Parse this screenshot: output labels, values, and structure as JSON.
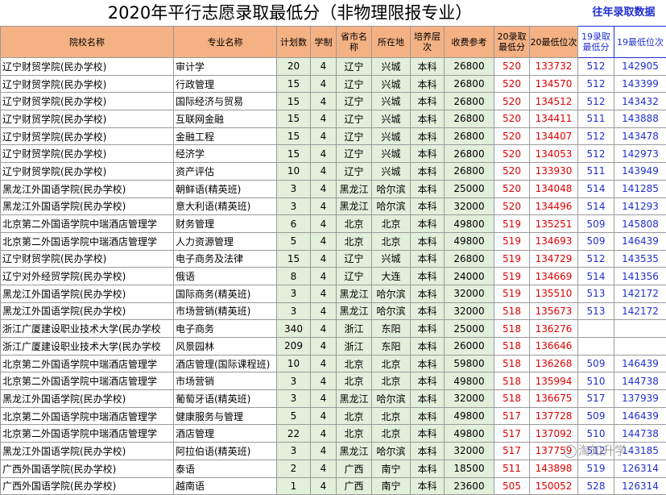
{
  "title": "2020年平行志愿录取最低分（非物理限报专业）",
  "side_title": "往年录取数据",
  "columns": [
    "院校名称",
    "专业名称",
    "计划数",
    "学制",
    "省市名称",
    "所在地",
    "培养层次",
    "收费参考",
    "20录取最低分",
    "20最低位次",
    "19录取最低分",
    "19最低位次"
  ],
  "rows": [
    [
      "辽宁财贸学院(民办学校)",
      "审计学",
      "20",
      "4",
      "辽宁",
      "兴城",
      "本科",
      "26800",
      "520",
      "133732",
      "512",
      "142905"
    ],
    [
      "辽宁财贸学院(民办学校)",
      "行政管理",
      "15",
      "4",
      "辽宁",
      "兴城",
      "本科",
      "26800",
      "520",
      "134570",
      "512",
      "143399"
    ],
    [
      "辽宁财贸学院(民办学校)",
      "国际经济与贸易",
      "15",
      "4",
      "辽宁",
      "兴城",
      "本科",
      "26800",
      "520",
      "134512",
      "512",
      "143432"
    ],
    [
      "辽宁财贸学院(民办学校)",
      "互联网金融",
      "15",
      "4",
      "辽宁",
      "兴城",
      "本科",
      "26800",
      "520",
      "134411",
      "511",
      "143888"
    ],
    [
      "辽宁财贸学院(民办学校)",
      "金融工程",
      "15",
      "4",
      "辽宁",
      "兴城",
      "本科",
      "26800",
      "520",
      "134407",
      "512",
      "143478"
    ],
    [
      "辽宁财贸学院(民办学校)",
      "经济学",
      "15",
      "4",
      "辽宁",
      "兴城",
      "本科",
      "26800",
      "520",
      "134053",
      "512",
      "142973"
    ],
    [
      "辽宁财贸学院(民办学校)",
      "资产评估",
      "10",
      "4",
      "辽宁",
      "兴城",
      "本科",
      "26800",
      "520",
      "133930",
      "511",
      "143949"
    ],
    [
      "黑龙江外国语学院(民办学校)",
      "朝鲜语(精英班)",
      "3",
      "4",
      "黑龙江",
      "哈尔滨",
      "本科",
      "25000",
      "520",
      "134048",
      "514",
      "141285"
    ],
    [
      "黑龙江外国语学院(民办学校)",
      "意大利语(精英班)",
      "3",
      "4",
      "黑龙江",
      "哈尔滨",
      "本科",
      "32000",
      "520",
      "134496",
      "514",
      "141293"
    ],
    [
      "北京第二外国语学院中瑞酒店管理学",
      "财务管理",
      "6",
      "4",
      "北京",
      "北京",
      "本科",
      "49800",
      "519",
      "135251",
      "509",
      "145808"
    ],
    [
      "北京第二外国语学院中瑞酒店管理学",
      "人力资源管理",
      "5",
      "4",
      "北京",
      "北京",
      "本科",
      "49800",
      "519",
      "134693",
      "509",
      "146439"
    ],
    [
      "辽宁财贸学院(民办学校)",
      "电子商务及法律",
      "15",
      "4",
      "辽宁",
      "兴城",
      "本科",
      "26800",
      "519",
      "134729",
      "512",
      "143535"
    ],
    [
      "辽宁对外经贸学院(民办学校)",
      "俄语",
      "8",
      "4",
      "辽宁",
      "大连",
      "本科",
      "24000",
      "519",
      "134669",
      "514",
      "141356"
    ],
    [
      "黑龙江外国语学院(民办学校)",
      "国际商务(精英班)",
      "3",
      "4",
      "黑龙江",
      "哈尔滨",
      "本科",
      "32000",
      "519",
      "135510",
      "513",
      "142172"
    ],
    [
      "黑龙江外国语学院(民办学校)",
      "市场营销(精英班)",
      "3",
      "4",
      "黑龙江",
      "哈尔滨",
      "本科",
      "32000",
      "518",
      "135673",
      "513",
      "142172"
    ],
    [
      "浙江广厦建设职业技术大学(民办学校",
      "电子商务",
      "340",
      "4",
      "浙江",
      "东阳",
      "本科",
      "25000",
      "518",
      "136276",
      "",
      ""
    ],
    [
      "浙江广厦建设职业技术大学(民办学校",
      "风景园林",
      "209",
      "4",
      "浙江",
      "东阳",
      "本科",
      "26000",
      "518",
      "136646",
      "",
      ""
    ],
    [
      "北京第二外国语学院中瑞酒店管理学",
      "酒店管理(国际课程班)",
      "10",
      "4",
      "北京",
      "北京",
      "本科",
      "59800",
      "518",
      "136268",
      "509",
      "146439"
    ],
    [
      "北京第二外国语学院中瑞酒店管理学",
      "市场营销",
      "3",
      "4",
      "北京",
      "北京",
      "本科",
      "49800",
      "518",
      "135994",
      "510",
      "144738"
    ],
    [
      "黑龙江外国语学院(民办学校)",
      "葡萄牙语(精英班)",
      "3",
      "4",
      "黑龙江",
      "哈尔滨",
      "本科",
      "32000",
      "518",
      "136675",
      "517",
      "137939"
    ],
    [
      "北京第二外国语学院中瑞酒店管理学",
      "健康服务与管理",
      "5",
      "4",
      "北京",
      "北京",
      "本科",
      "49800",
      "517",
      "137728",
      "509",
      "146439"
    ],
    [
      "北京第二外国语学院中瑞酒店管理学",
      "酒店管理",
      "22",
      "4",
      "北京",
      "北京",
      "本科",
      "49800",
      "517",
      "137092",
      "510",
      "144738"
    ],
    [
      "黑龙江外国语学院(民办学校)",
      "阿拉伯语(精英班)",
      "3",
      "4",
      "黑龙江",
      "哈尔滨",
      "本科",
      "32000",
      "517",
      "137759",
      "512",
      "143185"
    ],
    [
      "广西外国语学院(民办学校)",
      "泰语",
      "2",
      "4",
      "广西",
      "南宁",
      "本科",
      "18500",
      "511",
      "143898",
      "519",
      "126314"
    ],
    [
      "广西外国语学院(民办学校)",
      "越南语",
      "1",
      "4",
      "广西",
      "南宁",
      "本科",
      "23600",
      "505",
      "150052",
      "528",
      "126314"
    ]
  ],
  "watermark": "淘知升学",
  "colors": {
    "header_bg": "#f4b183",
    "cell_bg": "#e2efda",
    "red": "#e00000",
    "blue": "#1f2fd0"
  }
}
